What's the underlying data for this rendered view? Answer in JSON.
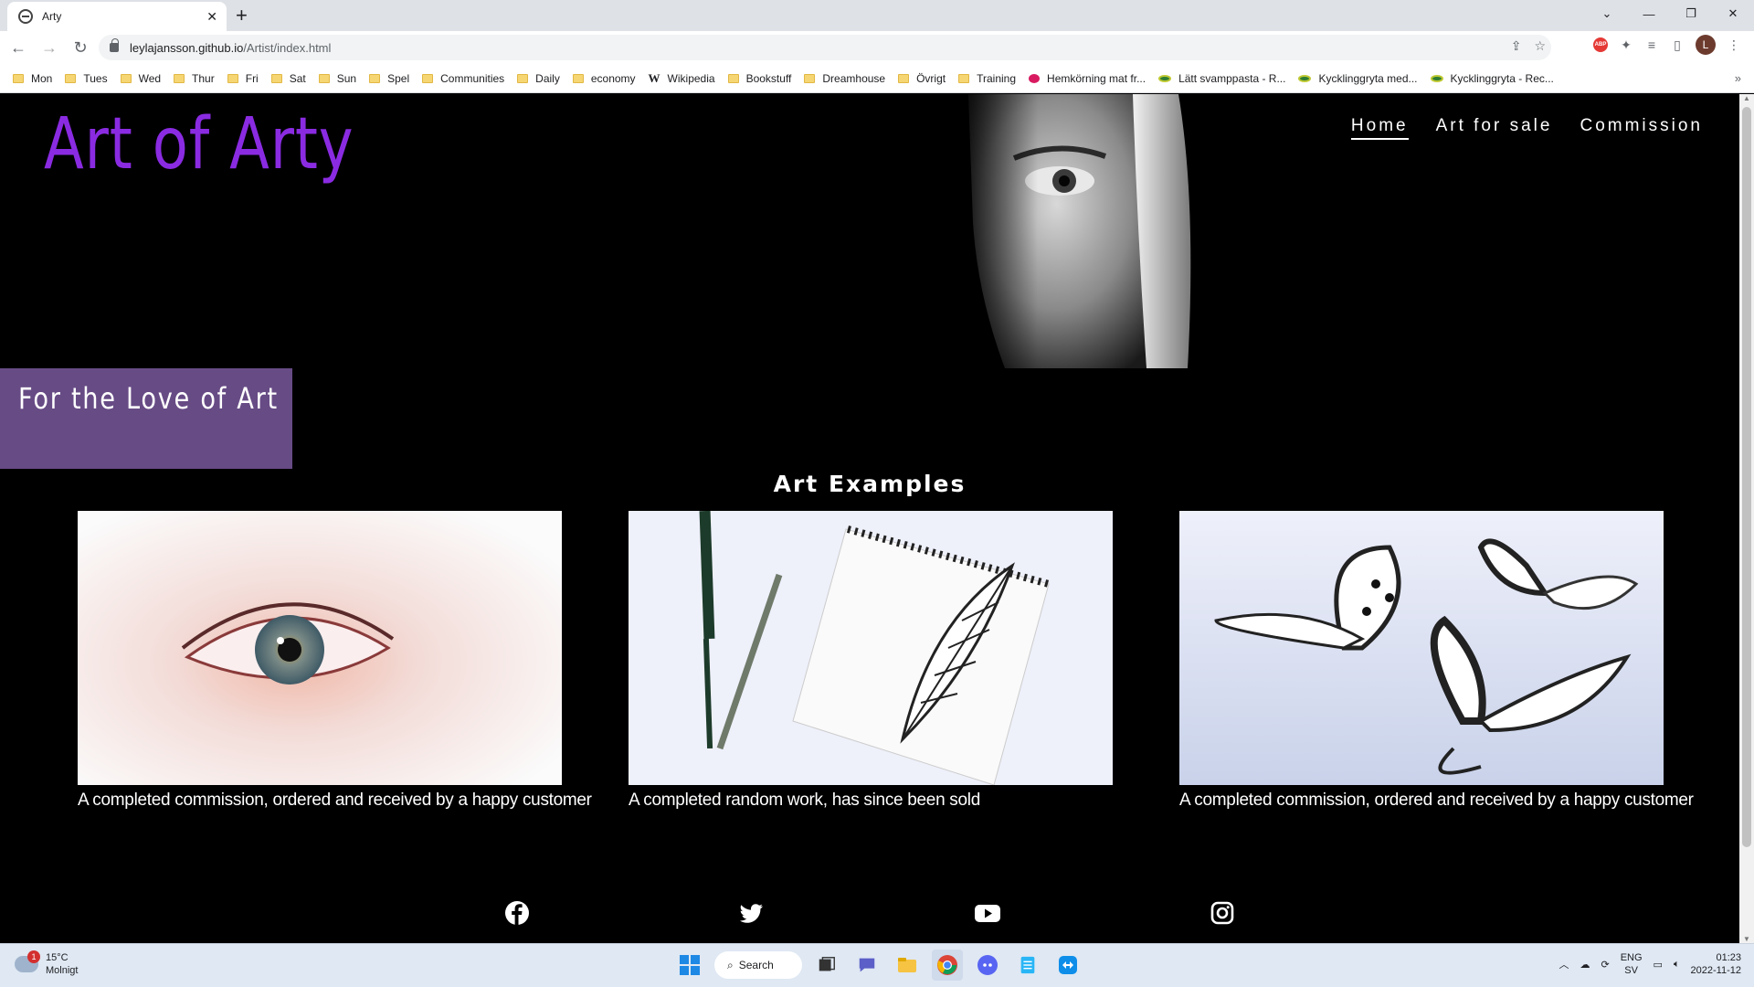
{
  "browser": {
    "tab_title": "Arty",
    "tab_close": "✕",
    "new_tab": "+",
    "url_host": "leylajansson.github.io",
    "url_path": "/Artist/index.html",
    "profile_initial": "L",
    "abp_label": "ABP",
    "bookmarks": [
      {
        "label": "Mon",
        "icon": "folder-icon"
      },
      {
        "label": "Tues",
        "icon": "folder-icon"
      },
      {
        "label": "Wed",
        "icon": "folder-icon"
      },
      {
        "label": "Thur",
        "icon": "folder-icon"
      },
      {
        "label": "Fri",
        "icon": "folder-icon"
      },
      {
        "label": "Sat",
        "icon": "folder-icon"
      },
      {
        "label": "Sun",
        "icon": "folder-icon"
      },
      {
        "label": "Spel",
        "icon": "folder-icon"
      },
      {
        "label": "Communities",
        "icon": "folder-icon"
      },
      {
        "label": "Daily",
        "icon": "folder-icon"
      },
      {
        "label": "economy",
        "icon": "folder-icon"
      },
      {
        "label": "Wikipedia",
        "icon": "wikipedia-icon"
      },
      {
        "label": "Bookstuff",
        "icon": "folder-icon"
      },
      {
        "label": "Dreamhouse",
        "icon": "folder-icon"
      },
      {
        "label": "Övrigt",
        "icon": "folder-icon"
      },
      {
        "label": "Training",
        "icon": "folder-icon"
      },
      {
        "label": "Hemkörning mat fr...",
        "icon": "site-icon"
      },
      {
        "label": "Lätt svamppasta - R...",
        "icon": "recipe-site-icon"
      },
      {
        "label": "Kycklinggryta med...",
        "icon": "recipe-site-icon"
      },
      {
        "label": "Kycklinggryta - Rec...",
        "icon": "recipe-site-icon"
      }
    ]
  },
  "site": {
    "logo": "Art of Arty",
    "nav": [
      {
        "label": "Home",
        "active": true
      },
      {
        "label": "Art for sale",
        "active": false
      },
      {
        "label": "Commission",
        "active": false
      }
    ],
    "tagline": "For the Love of Art",
    "section_title": "Art Examples",
    "cards": [
      {
        "caption": "A completed commission, ordered and received by a happy customer",
        "image": "eye-closeup-image"
      },
      {
        "caption": "A completed random work, has since been sold",
        "image": "feather-sketch-image"
      },
      {
        "caption": "A completed commission, ordered and received by a happy customer",
        "image": "butterflies-image"
      }
    ],
    "social": [
      "facebook-icon",
      "twitter-icon",
      "youtube-icon",
      "instagram-icon"
    ]
  },
  "taskbar": {
    "weather_temp": "15°C",
    "weather_desc": "Molnigt",
    "weather_badge": "1",
    "search_label": "Search",
    "lang_primary": "ENG",
    "lang_secondary": "SV",
    "time": "01:23",
    "date": "2022-11-12"
  }
}
